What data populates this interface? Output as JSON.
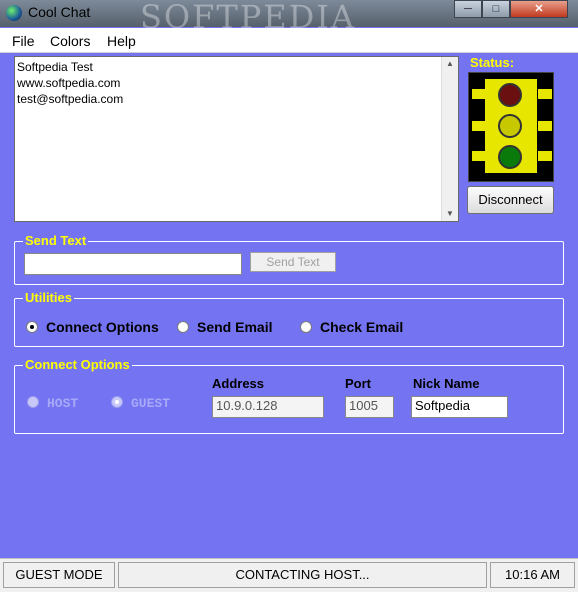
{
  "window": {
    "title": "Cool Chat",
    "watermark": "SOFTPEDIA",
    "buttons": {
      "minimize": "─",
      "maximize": "□",
      "close": "✕"
    }
  },
  "menu": {
    "items": [
      "File",
      "Colors",
      "Help"
    ]
  },
  "chat": {
    "lines": [
      "Softpedia Test",
      "www.softpedia.com",
      "test@softpedia.com"
    ],
    "scroll_up": "▲",
    "scroll_down": "▼"
  },
  "status": {
    "label": "Status:",
    "disconnect_label": "Disconnect",
    "lights": {
      "red": "#6a1010",
      "yellow": "#c8c800",
      "green": "#0a7a0a"
    }
  },
  "send_text": {
    "legend": "Send Text",
    "input_value": "",
    "button_label": "Send Text"
  },
  "utilities": {
    "legend": "Utilities",
    "options": [
      {
        "label": "Connect Options",
        "selected": true
      },
      {
        "label": "Send Email",
        "selected": false
      },
      {
        "label": "Check Email",
        "selected": false
      }
    ]
  },
  "connect_options": {
    "legend": "Connect Options",
    "modes": [
      {
        "label": "HOST",
        "selected": false
      },
      {
        "label": "GUEST",
        "selected": true
      }
    ],
    "address_label": "Address",
    "address_value": "10.9.0.128",
    "port_label": "Port",
    "port_value": "1005",
    "nick_label": "Nick Name",
    "nick_value": "Softpedia"
  },
  "statusbar": {
    "mode": "GUEST MODE",
    "message": "CONTACTING HOST...",
    "time": "10:16 AM"
  },
  "colors": {
    "background": "#7474f2",
    "legend_text": "#ffff00",
    "group_border": "#ffffff"
  }
}
